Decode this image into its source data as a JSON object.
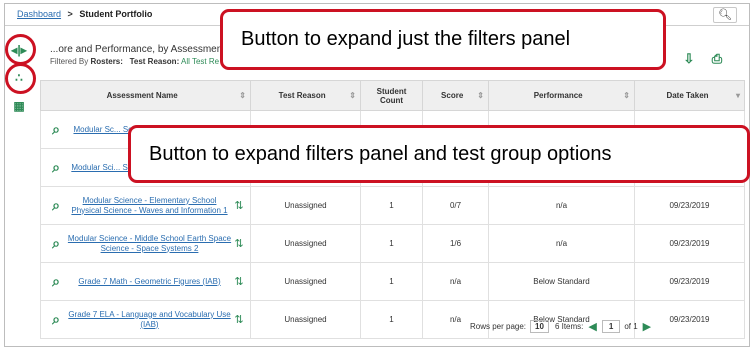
{
  "breadcrumb": {
    "home": "Dashboard",
    "separator": ">",
    "current": "Student Portfolio"
  },
  "heading": "...ore and Performance, by Assessment a",
  "filters": {
    "label": "Filtered By",
    "rosters_label": "Rosters:",
    "test_reason_label": "Test Reason:",
    "test_reason_value": "All Test Re"
  },
  "table": {
    "columns": [
      "Assessment Name",
      "Test Reason",
      "Student Count",
      "Score",
      "Performance",
      "Date Taken"
    ],
    "rows": [
      {
        "name": "Modular Sc... Science - Gr... Reproductio...",
        "reason": "",
        "count": "",
        "score": "",
        "perf": "",
        "date": ""
      },
      {
        "name": "Modular Sci... Science - St... Information P...",
        "reason": "",
        "count": "",
        "score": "",
        "perf": "",
        "date": ""
      },
      {
        "name": "Modular Science - Elementary School Physical Science - Waves and Information 1",
        "reason": "Unassigned",
        "count": "1",
        "score": "0/7",
        "perf": "n/a",
        "date": "09/23/2019"
      },
      {
        "name": "Modular Science - Middle School Earth Space Science - Space Systems 2",
        "reason": "Unassigned",
        "count": "1",
        "score": "1/6",
        "perf": "n/a",
        "date": "09/23/2019"
      },
      {
        "name": "Grade 7 Math - Geometric Figures (IAB)",
        "reason": "Unassigned",
        "count": "1",
        "score": "n/a",
        "perf": "Below Standard",
        "date": "09/23/2019"
      },
      {
        "name": "Grade 7 ELA - Language and Vocabulary Use (IAB)",
        "reason": "Unassigned",
        "count": "1",
        "score": "n/a",
        "perf": "Below Standard",
        "date": "09/23/2019"
      }
    ]
  },
  "pager": {
    "rows_label": "Rows per page:",
    "rows_value": "10",
    "items": "6 Items:",
    "page": "1",
    "of": "of 1"
  },
  "callouts": {
    "filters_only": "Button to expand just the filters panel",
    "filters_and_groups": "Button to expand filters panel and test group options"
  },
  "icons": [
    "expand-filters-icon",
    "expand-filters-groups-icon",
    "calendar-icon",
    "search-icon",
    "magnifier-icon",
    "reorder-icon",
    "print-icon",
    "download-icon"
  ],
  "colors": {
    "accent": "#2e8b57",
    "link": "#2a6db0",
    "callout_border": "#cc1122"
  }
}
